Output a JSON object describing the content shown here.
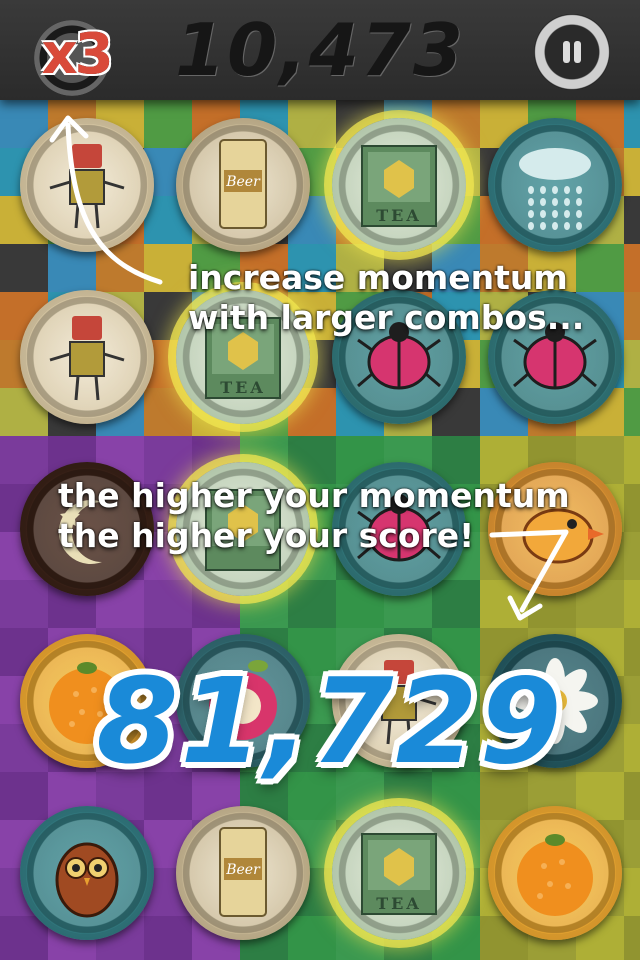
{
  "hud": {
    "multiplier": "x3",
    "score": "10,473",
    "pause_icon": "pause-icon"
  },
  "tutorial": {
    "hint_one_line1": "increase momentum",
    "hint_one_line2": "with larger combos...",
    "hint_two_line1": "the higher your momentum",
    "hint_two_line2": "the higher your score!"
  },
  "combo_score": "81,729",
  "board": {
    "caps": [
      {
        "icon": "robot-icon",
        "label": ""
      },
      {
        "icon": "beer-can-icon",
        "label": ""
      },
      {
        "icon": "tea-tin-icon",
        "label": "TEA"
      },
      {
        "icon": "rain-cloud-icon",
        "label": ""
      },
      {
        "icon": "robot-icon",
        "label": ""
      },
      {
        "icon": "tea-tin-icon",
        "label": "TEA"
      },
      {
        "icon": "ladybug-icon",
        "label": ""
      },
      {
        "icon": "ladybug-icon",
        "label": ""
      },
      {
        "icon": "moon-icon",
        "label": ""
      },
      {
        "icon": "tea-tin-icon",
        "label": ""
      },
      {
        "icon": "ladybug-icon",
        "label": ""
      },
      {
        "icon": "bird-icon",
        "label": ""
      },
      {
        "icon": "orange-icon",
        "label": ""
      },
      {
        "icon": "apple-icon",
        "label": ""
      },
      {
        "icon": "robot-icon",
        "label": ""
      },
      {
        "icon": "flower-icon",
        "label": ""
      },
      {
        "icon": "owl-icon",
        "label": ""
      },
      {
        "icon": "beer-can-icon",
        "label": ""
      },
      {
        "icon": "tea-tin-icon",
        "label": "TEA"
      },
      {
        "icon": "orange-icon",
        "label": ""
      }
    ]
  },
  "colors": {
    "score_blue": "#1a8ad8",
    "multiplier_red": "#d94a3a",
    "glow_yellow": "#f0e650"
  }
}
